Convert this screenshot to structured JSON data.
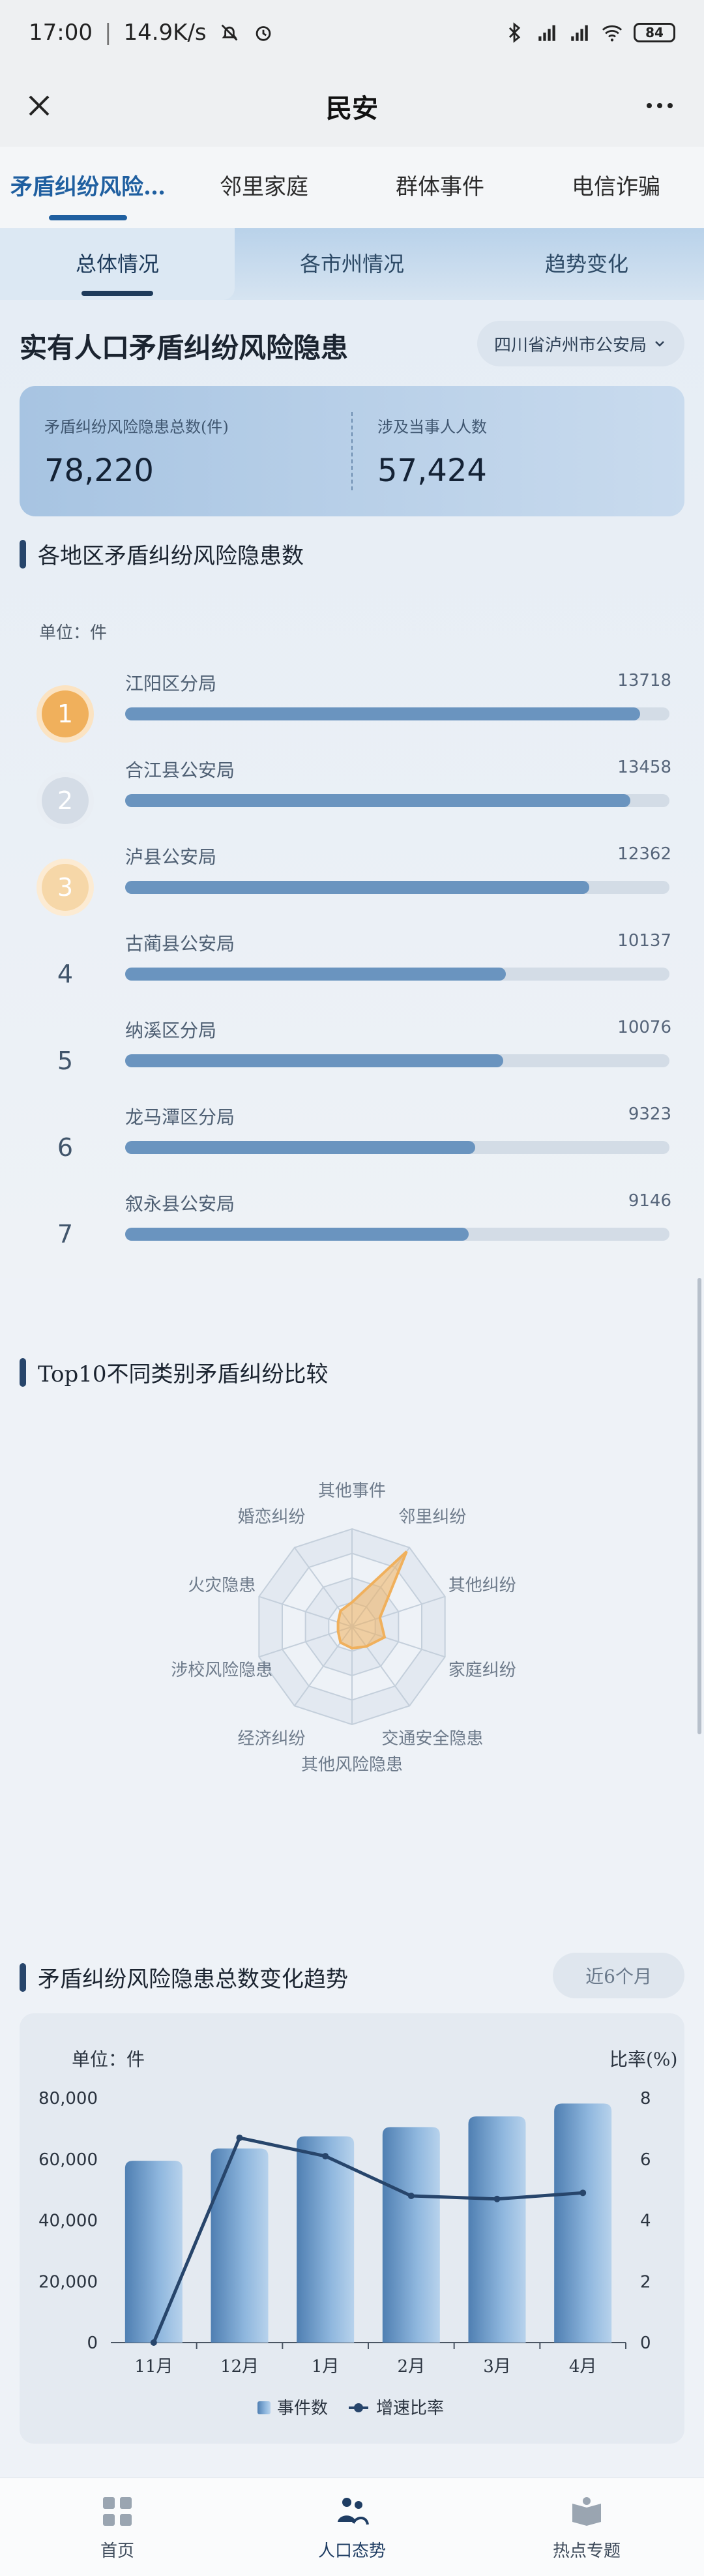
{
  "status_bar": {
    "time": "17:00",
    "speed": "14.9K/s",
    "battery": "84"
  },
  "titlebar": {
    "title": "民安"
  },
  "top_tabs": [
    "矛盾纠纷风险…",
    "邻里家庭",
    "群体事件",
    "电信诈骗"
  ],
  "sub_tabs": [
    "总体情况",
    "各市州情况",
    "趋势变化"
  ],
  "header": {
    "title": "实有人口矛盾纠纷风险隐患",
    "region": "四川省泸州市公安局"
  },
  "stats": [
    {
      "label": "矛盾纠纷风险隐患总数(件)",
      "value": "78,220"
    },
    {
      "label": "涉及当事人人数",
      "value": "57,424"
    }
  ],
  "ranking": {
    "title": "各地区矛盾纠纷风险隐患数",
    "unit": "单位：件",
    "max": 14500,
    "items": [
      {
        "rank": "1",
        "name": "江阳区分局",
        "value": 13718
      },
      {
        "rank": "2",
        "name": "合江县公安局",
        "value": 13458
      },
      {
        "rank": "3",
        "name": "泸县公安局",
        "value": 12362
      },
      {
        "rank": "4",
        "name": "古蔺县公安局",
        "value": 10137
      },
      {
        "rank": "5",
        "name": "纳溪区分局",
        "value": 10076
      },
      {
        "rank": "6",
        "name": "龙马潭区分局",
        "value": 9323
      },
      {
        "rank": "7",
        "name": "叙永县公安局",
        "value": 9146
      }
    ]
  },
  "radar": {
    "title": "Top10不同类别矛盾纠纷比较",
    "axes": [
      "其他事件",
      "邻里纠纷",
      "其他纠纷",
      "家庭纠纷",
      "交通安全隐患",
      "其他风险隐患",
      "经济纠纷",
      "涉校风险隐患",
      "火灾隐患",
      "婚恋纠纷"
    ],
    "values": [
      0.25,
      0.95,
      0.3,
      0.35,
      0.25,
      0.22,
      0.2,
      0.15,
      0.15,
      0.2
    ],
    "color": "#f0b05c"
  },
  "trend": {
    "title": "矛盾纠纷风险隐患总数变化趋势",
    "period_button": "近6个月",
    "left_unit": "单位：件",
    "right_unit": "比率(%)",
    "legend_bar": "事件数",
    "legend_line": "增速比率"
  },
  "chart_data": {
    "type": "bar",
    "categories": [
      "11月",
      "12月",
      "1月",
      "2月",
      "3月",
      "4月"
    ],
    "series": [
      {
        "name": "事件数",
        "type": "bar",
        "values": [
          59500,
          63500,
          67500,
          70500,
          74000,
          78220
        ]
      },
      {
        "name": "增速比率",
        "type": "line",
        "values": [
          0,
          6.7,
          6.1,
          4.8,
          4.7,
          4.9
        ]
      }
    ],
    "ylim": [
      0,
      80000
    ],
    "y2lim": [
      0,
      8
    ],
    "yticks": [
      "0",
      "20,000",
      "40,000",
      "60,000",
      "80,000"
    ],
    "y2ticks": [
      "0",
      "2",
      "4",
      "6",
      "8"
    ],
    "colors": {
      "bar": "#6d9fcf",
      "line": "#27456b"
    }
  },
  "bottom_nav": [
    {
      "label": "首页"
    },
    {
      "label": "人口态势"
    },
    {
      "label": "热点专题"
    }
  ]
}
